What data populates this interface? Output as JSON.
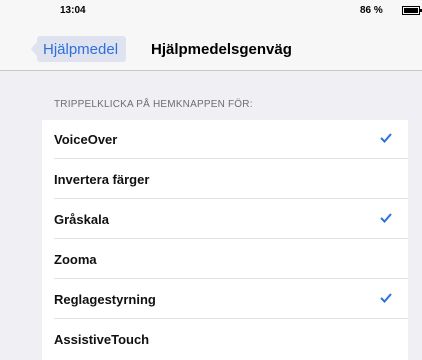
{
  "status_bar": {
    "time": "13:04",
    "battery": "86 %"
  },
  "nav": {
    "back_label": "Hjälpmedel",
    "title": "Hjälpmedelsgenväg"
  },
  "section": {
    "header": "TRIPPELKLICKA PÅ HEMKNAPPEN FÖR:",
    "items": [
      {
        "label": "VoiceOver",
        "checked": true
      },
      {
        "label": "Invertera färger",
        "checked": false
      },
      {
        "label": "Gråskala",
        "checked": true
      },
      {
        "label": "Zooma",
        "checked": false
      },
      {
        "label": "Reglagestyrning",
        "checked": true
      },
      {
        "label": "AssistiveTouch",
        "checked": false
      }
    ]
  },
  "colors": {
    "accent": "#2f6fdc",
    "background": "#efeff4"
  },
  "icons": {
    "check": "checkmark-icon",
    "back": "chevron-left-icon",
    "battery": "battery-icon"
  }
}
